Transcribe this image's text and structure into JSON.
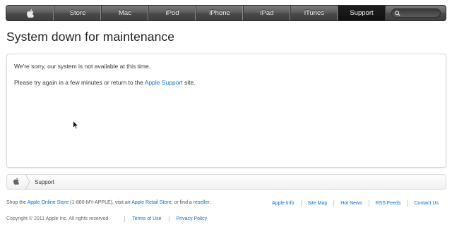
{
  "nav": {
    "items": [
      {
        "label": "Store"
      },
      {
        "label": "Mac"
      },
      {
        "label": "iPod"
      },
      {
        "label": "iPhone"
      },
      {
        "label": "iPad"
      },
      {
        "label": "iTunes"
      },
      {
        "label": "Support",
        "active": true
      }
    ],
    "logo_icon": "apple-logo-icon",
    "search_icon": "search-icon"
  },
  "page": {
    "title": "System down for maintenance"
  },
  "message": {
    "line1": "We're sorry, our system is not available at this time.",
    "line2_prefix": "Please try again in a few minutes or return to the ",
    "line2_link": "Apple Support",
    "line2_suffix": " site."
  },
  "breadcrumb": {
    "home_icon": "apple-logo-icon",
    "current": "Support"
  },
  "footer": {
    "shop_prefix": "Shop the ",
    "online_store": "Apple Online Store",
    "phone": " (1-800-MY-APPLE), visit an ",
    "retail_store": "Apple Retail Store",
    "or_find": ", or find a ",
    "reseller": "reseller",
    "period": ".",
    "links": [
      "Apple Info",
      "Site Map",
      "Hot News",
      "RSS Feeds",
      "Contact Us"
    ],
    "copyright": "Copyright © 2011 Apple Inc. All rights reserved.",
    "terms": "Terms of Use",
    "privacy": "Privacy Policy"
  },
  "colors": {
    "link": "#0b6fcb",
    "nav_active": "#111111"
  }
}
